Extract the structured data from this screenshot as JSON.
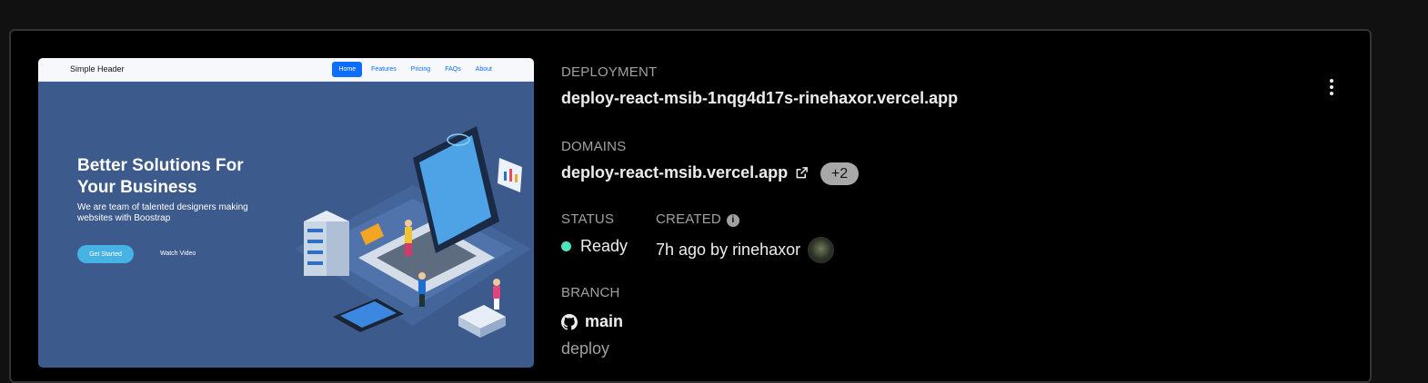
{
  "preview": {
    "brand": "Simple Header",
    "nav": [
      "Home",
      "Features",
      "Pricing",
      "FAQs",
      "About"
    ],
    "hero_title": "Better Solutions For Your Business",
    "hero_subtitle": "We are team of talented designers making websites with Boostrap",
    "cta_primary": "Get Started",
    "cta_secondary": "Watch Video"
  },
  "deployment": {
    "label": "DEPLOYMENT",
    "url": "deploy-react-msib-1nqg4d17s-rinehaxor.vercel.app"
  },
  "domains": {
    "label": "DOMAINS",
    "primary": "deploy-react-msib.vercel.app",
    "extra_count": "+2"
  },
  "status": {
    "label": "STATUS",
    "value": "Ready",
    "color": "#50e3c2"
  },
  "created": {
    "label": "CREATED",
    "info_icon": "i",
    "value": "7h ago by rinehaxor"
  },
  "branch": {
    "label": "BRANCH",
    "name": "main",
    "commit": "deploy"
  },
  "icons": {
    "external": "external-link-icon",
    "github": "github-icon",
    "menu": "more-vertical-icon"
  }
}
